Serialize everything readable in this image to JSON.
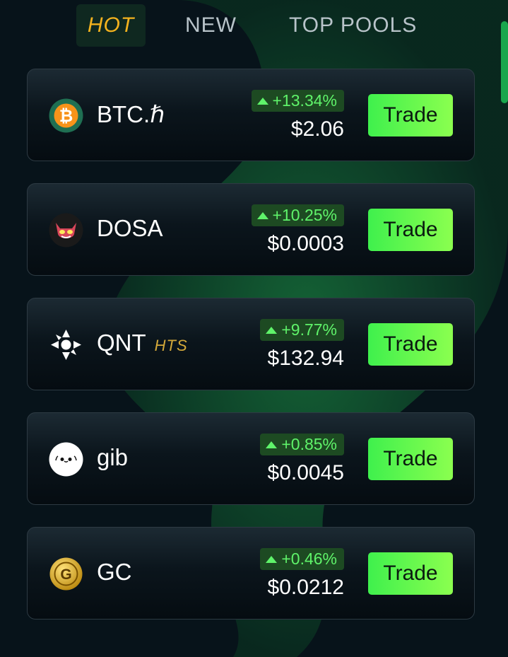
{
  "tabs": [
    {
      "label": "HOT",
      "active": true
    },
    {
      "label": "NEW",
      "active": false
    },
    {
      "label": "TOP POOLS",
      "active": false
    }
  ],
  "colors": {
    "background": "#07131a",
    "accent_green": "#5ff36a",
    "active_tab": "#f3b21e",
    "trade_button": "#3ff04d"
  },
  "tokens": [
    {
      "name": "BTC.ℏ",
      "tag": "",
      "icon": "btc-icon",
      "change": "+13.34%",
      "price": "$2.06",
      "trade_label": "Trade"
    },
    {
      "name": "DOSA",
      "tag": "",
      "icon": "dosa-icon",
      "change": "+10.25%",
      "price": "$0.0003",
      "trade_label": "Trade"
    },
    {
      "name": "QNT",
      "tag": "HTS",
      "icon": "qnt-icon",
      "change": "+9.77%",
      "price": "$132.94",
      "trade_label": "Trade"
    },
    {
      "name": "gib",
      "tag": "",
      "icon": "gib-icon",
      "change": "+0.85%",
      "price": "$0.0045",
      "trade_label": "Trade"
    },
    {
      "name": "GC",
      "tag": "",
      "icon": "gc-icon",
      "change": "+0.46%",
      "price": "$0.0212",
      "trade_label": "Trade"
    }
  ]
}
